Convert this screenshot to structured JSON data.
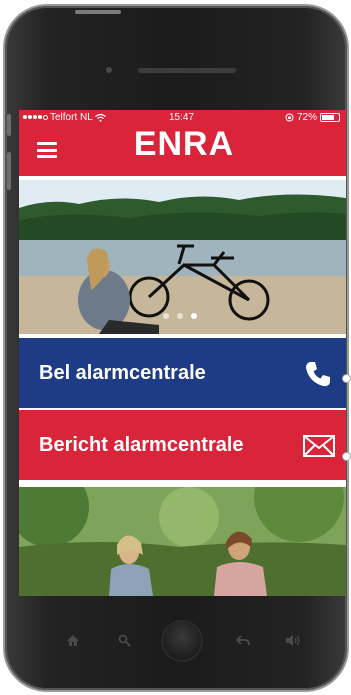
{
  "status_bar": {
    "carrier": "Telfort NL",
    "time": "15:47",
    "battery": "72%",
    "battery_level": 0.72
  },
  "header": {
    "logo": "ENRA",
    "menu_icon": "hamburger-menu-icon",
    "background_color": "#d9243a"
  },
  "carousel": {
    "slides": 3,
    "active_index": 2
  },
  "actions": [
    {
      "label": "Bel alarmcentrale",
      "icon": "phone-icon",
      "color": "#1d3c85"
    },
    {
      "label": "Bericht alarmcentrale",
      "icon": "envelope-icon",
      "color": "#d9243a"
    }
  ],
  "colors": {
    "brand_red": "#d9243a",
    "brand_blue": "#1d3c85"
  },
  "bottom_nav_icons": [
    "home-icon",
    "search-icon",
    "home-button",
    "back-icon",
    "volume-icon"
  ]
}
